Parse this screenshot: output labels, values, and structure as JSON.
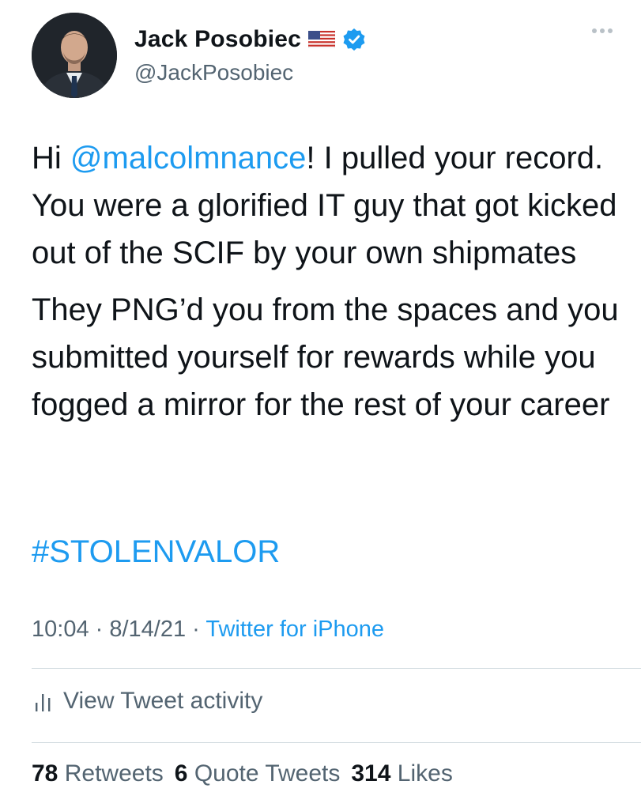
{
  "author": {
    "display_name": "Jack Posobiec",
    "handle": "@JackPosobiec",
    "flag_icon": "us-flag-icon",
    "verified_icon": "verified-badge-icon"
  },
  "tweet": {
    "p1_prefix": "Hi ",
    "p1_mention": "@malcolmnance",
    "p1_suffix": "! I pulled your record. You were a glorified IT guy that got kicked out of the SCIF by your own shipmates",
    "p2": "They PNG’d you from the spaces and you submitted yourself for rewards while you fogged a mirror for the rest of your career",
    "hashtag": "#STOLENVALOR"
  },
  "meta": {
    "time": "10:04",
    "separator1": " · ",
    "date": "8/14/21",
    "separator2": " · ",
    "source": "Twitter for iPhone"
  },
  "activity": {
    "label": "View Tweet activity"
  },
  "stats": {
    "retweets_count": "78",
    "retweets_label": "Retweets",
    "quotes_count": "6",
    "quotes_label": "Quote Tweets",
    "likes_count": "314",
    "likes_label": "Likes"
  },
  "colors": {
    "link": "#1d9bf0",
    "secondary": "#536471",
    "primary": "#0f1419",
    "divider": "#cfd9de"
  }
}
